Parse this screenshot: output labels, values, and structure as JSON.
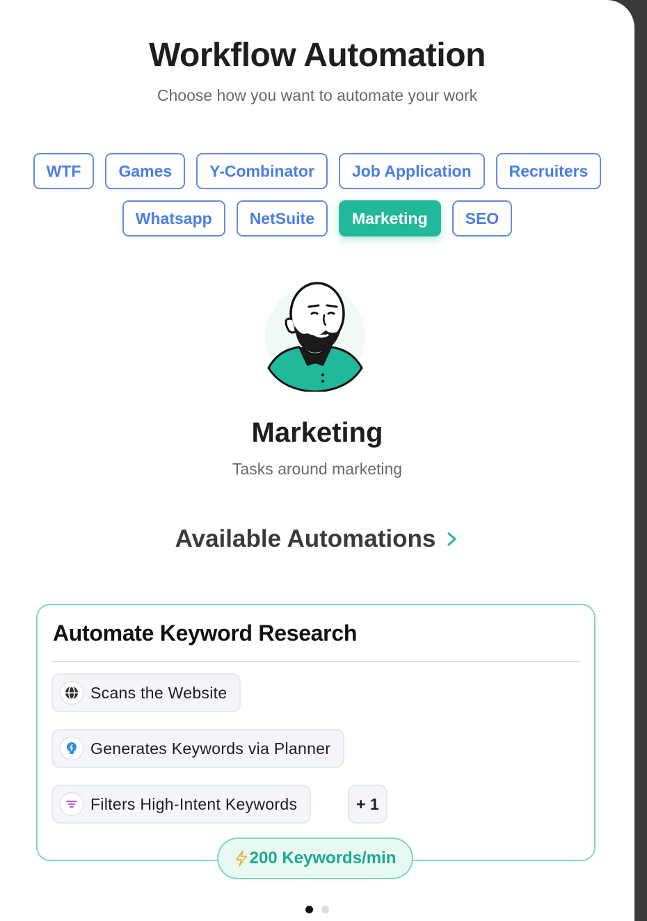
{
  "header": {
    "title": "Workflow Automation",
    "subtitle": "Choose how you want to automate your work"
  },
  "categories": {
    "row1": [
      "WTF",
      "Games",
      "Y-Combinator",
      "Job Application",
      "Recruiters"
    ],
    "row2": [
      "Whatsapp",
      "NetSuite",
      "Marketing",
      "SEO"
    ],
    "selected": "Marketing"
  },
  "category_detail": {
    "avatar_icon": "bald-bearded-man-avatar",
    "name": "Marketing",
    "description": "Tasks around marketing"
  },
  "automations": {
    "heading": "Available Automations",
    "heading_icon": "chevron-right-icon",
    "card": {
      "title": "Automate Keyword Research",
      "steps": [
        {
          "label": "Scans the Website",
          "icon": "globe-icon"
        },
        {
          "label": "Generates Keywords via Planner",
          "icon": "lightbulb-icon"
        },
        {
          "label": "Filters High-Intent Keywords",
          "icon": "filter-icon"
        }
      ],
      "more_label": "+ 1",
      "rate_icon": "lightning-icon",
      "rate_label": "200 Keywords/min"
    }
  },
  "pagination": {
    "total": 2,
    "current": 1
  },
  "colors": {
    "accent": "#22b89a",
    "tag_blue": "#4a7ee2",
    "card_border": "#7fd6c2"
  }
}
